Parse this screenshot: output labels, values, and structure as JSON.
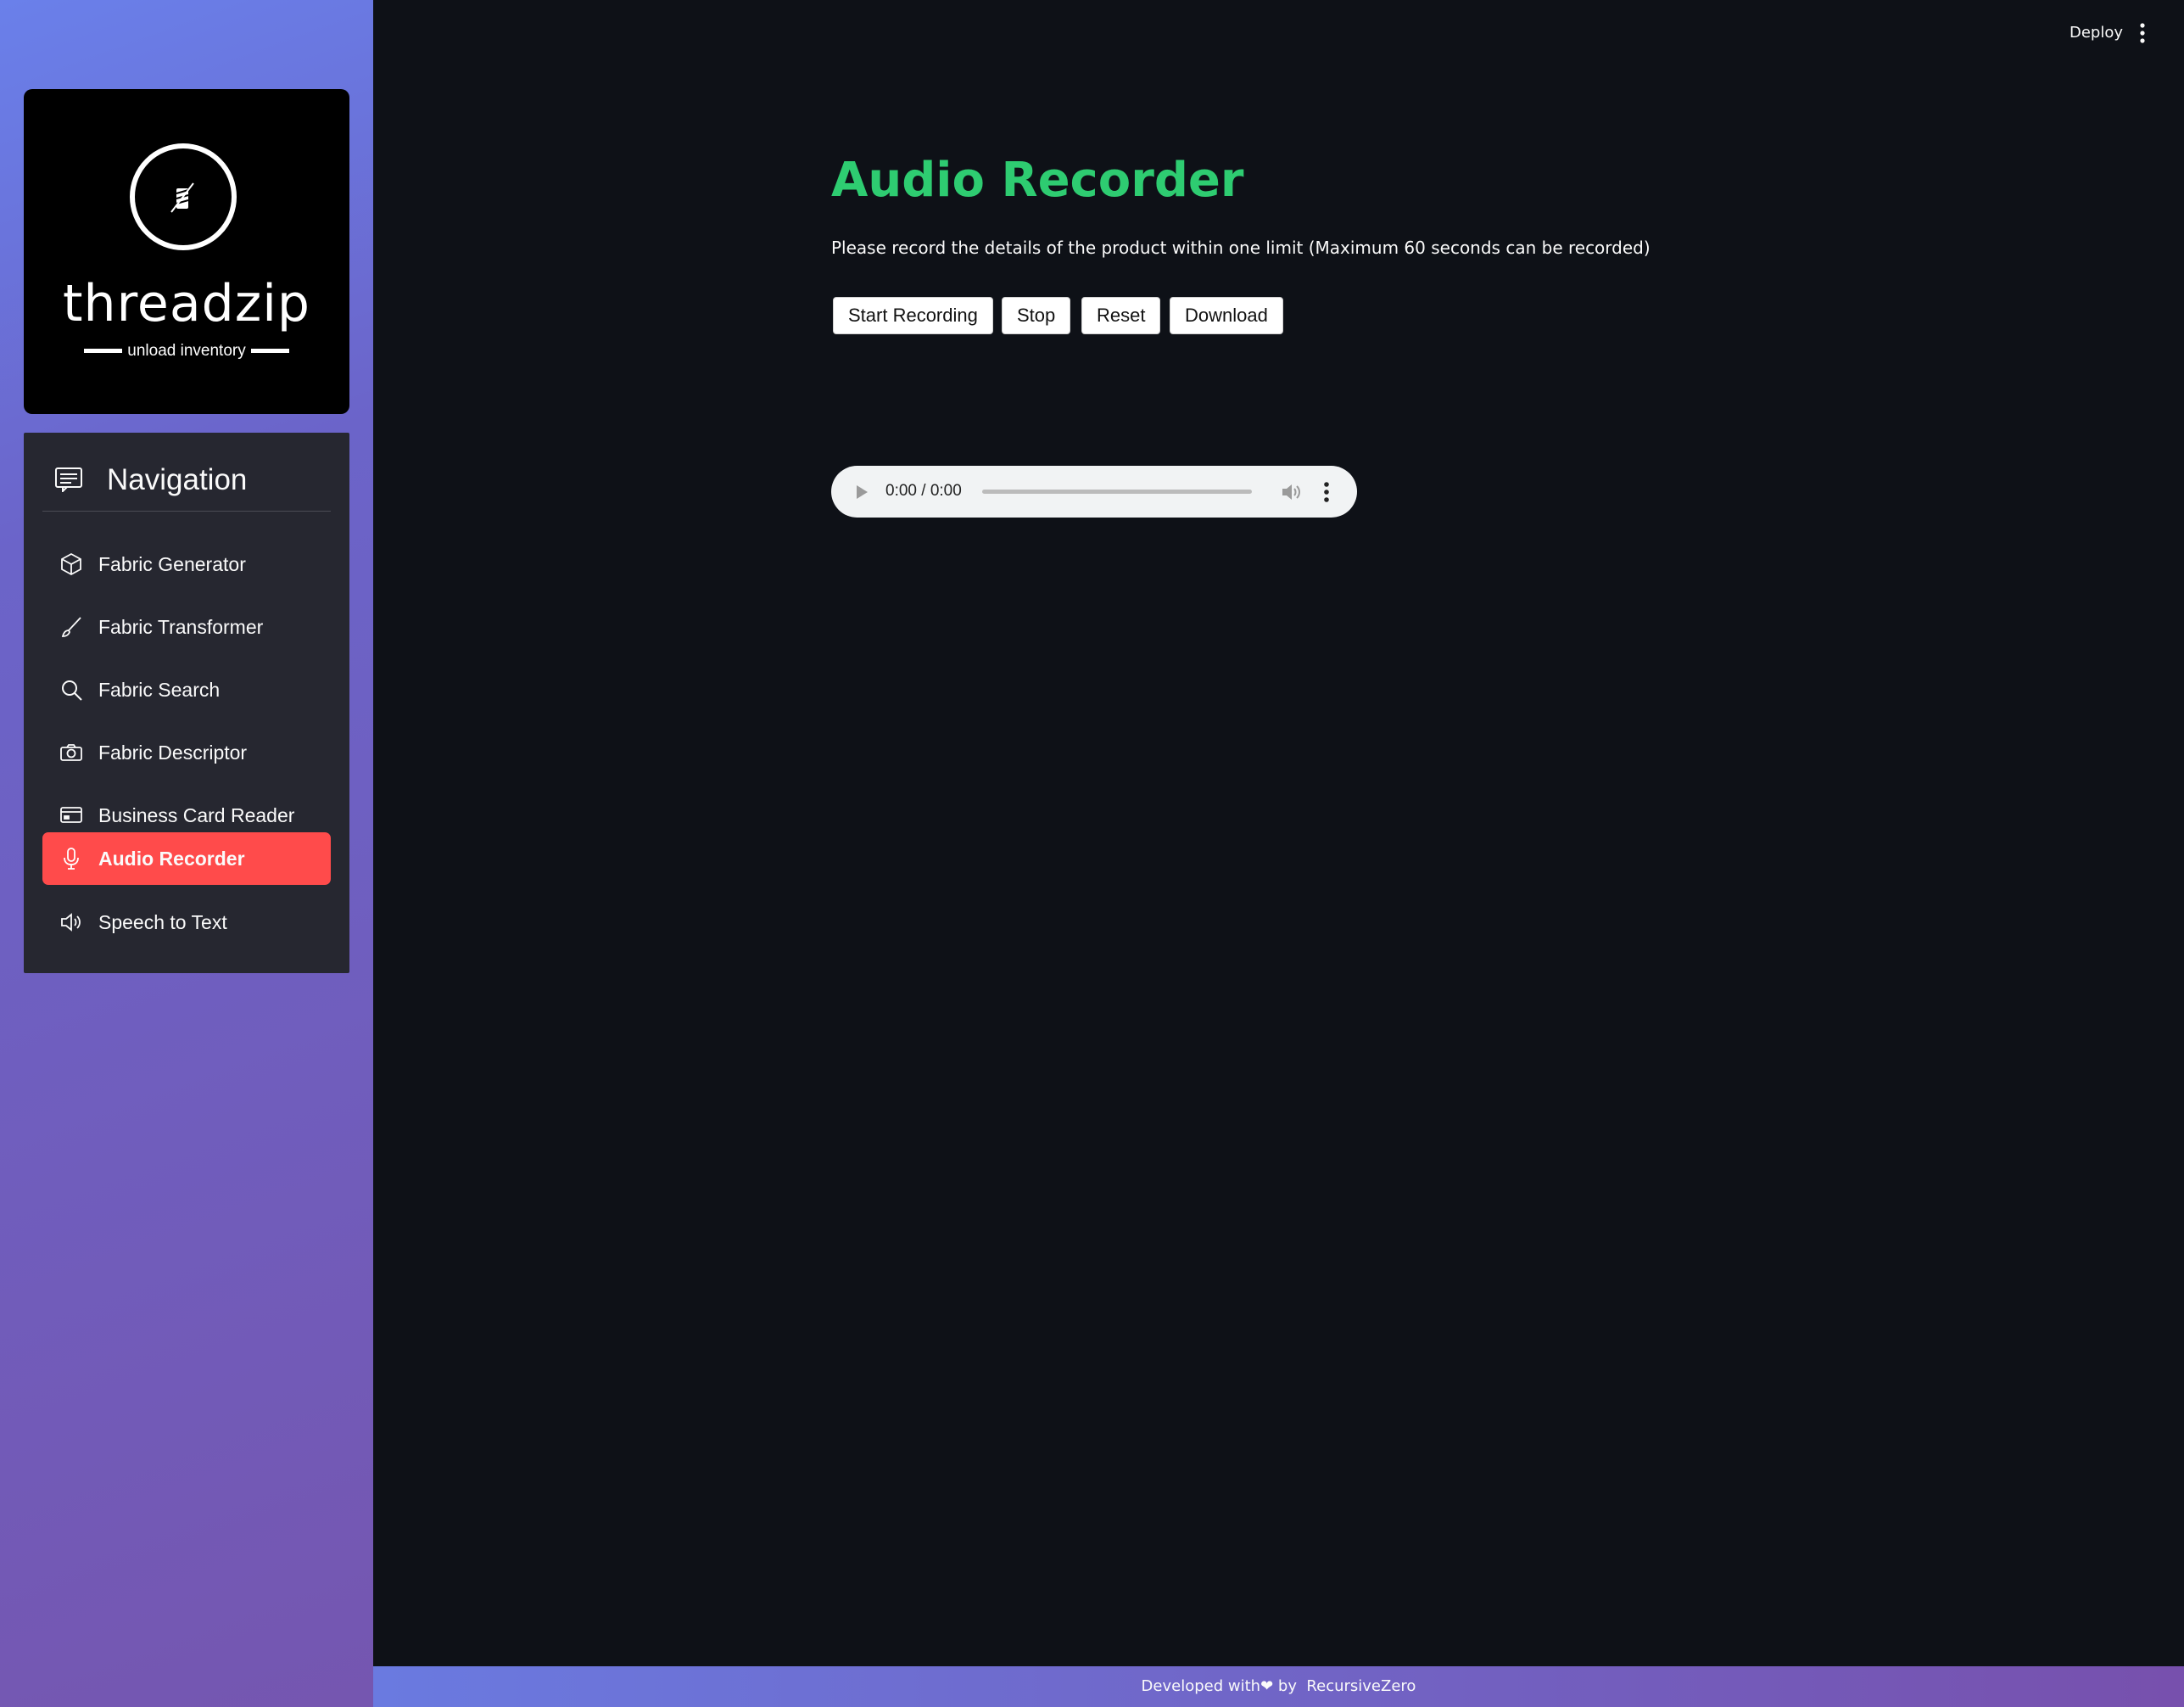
{
  "sidebar": {
    "logo": {
      "name": "threadzip",
      "tagline": "unload inventory"
    },
    "nav_title": "Navigation",
    "items": [
      {
        "label": "Fabric Generator",
        "icon": "box-icon"
      },
      {
        "label": "Fabric Transformer",
        "icon": "brush-icon"
      },
      {
        "label": "Fabric Search",
        "icon": "search-icon"
      },
      {
        "label": "Fabric Descriptor",
        "icon": "camera-icon"
      },
      {
        "label": "Business Card Reader",
        "icon": "card-icon"
      },
      {
        "label": "Audio Recorder",
        "icon": "mic-icon",
        "active": true
      },
      {
        "label": "Speech to Text",
        "icon": "speaker-icon"
      }
    ]
  },
  "topbar": {
    "deploy_label": "Deploy"
  },
  "main": {
    "title": "Audio Recorder",
    "description": "Please record the details of the product within one limit (Maximum 60 seconds can be recorded)",
    "buttons": {
      "start": "Start Recording",
      "stop": "Stop",
      "reset": "Reset",
      "download": "Download"
    },
    "player": {
      "time": "0:00 / 0:00"
    }
  },
  "footer": {
    "prefix": "Developed with",
    "by": "by",
    "author": "RecursiveZero"
  },
  "colors": {
    "title": "#2ecc71",
    "active_nav": "#ff4b4b",
    "background": "#0e1117",
    "nav_card": "#262730"
  }
}
